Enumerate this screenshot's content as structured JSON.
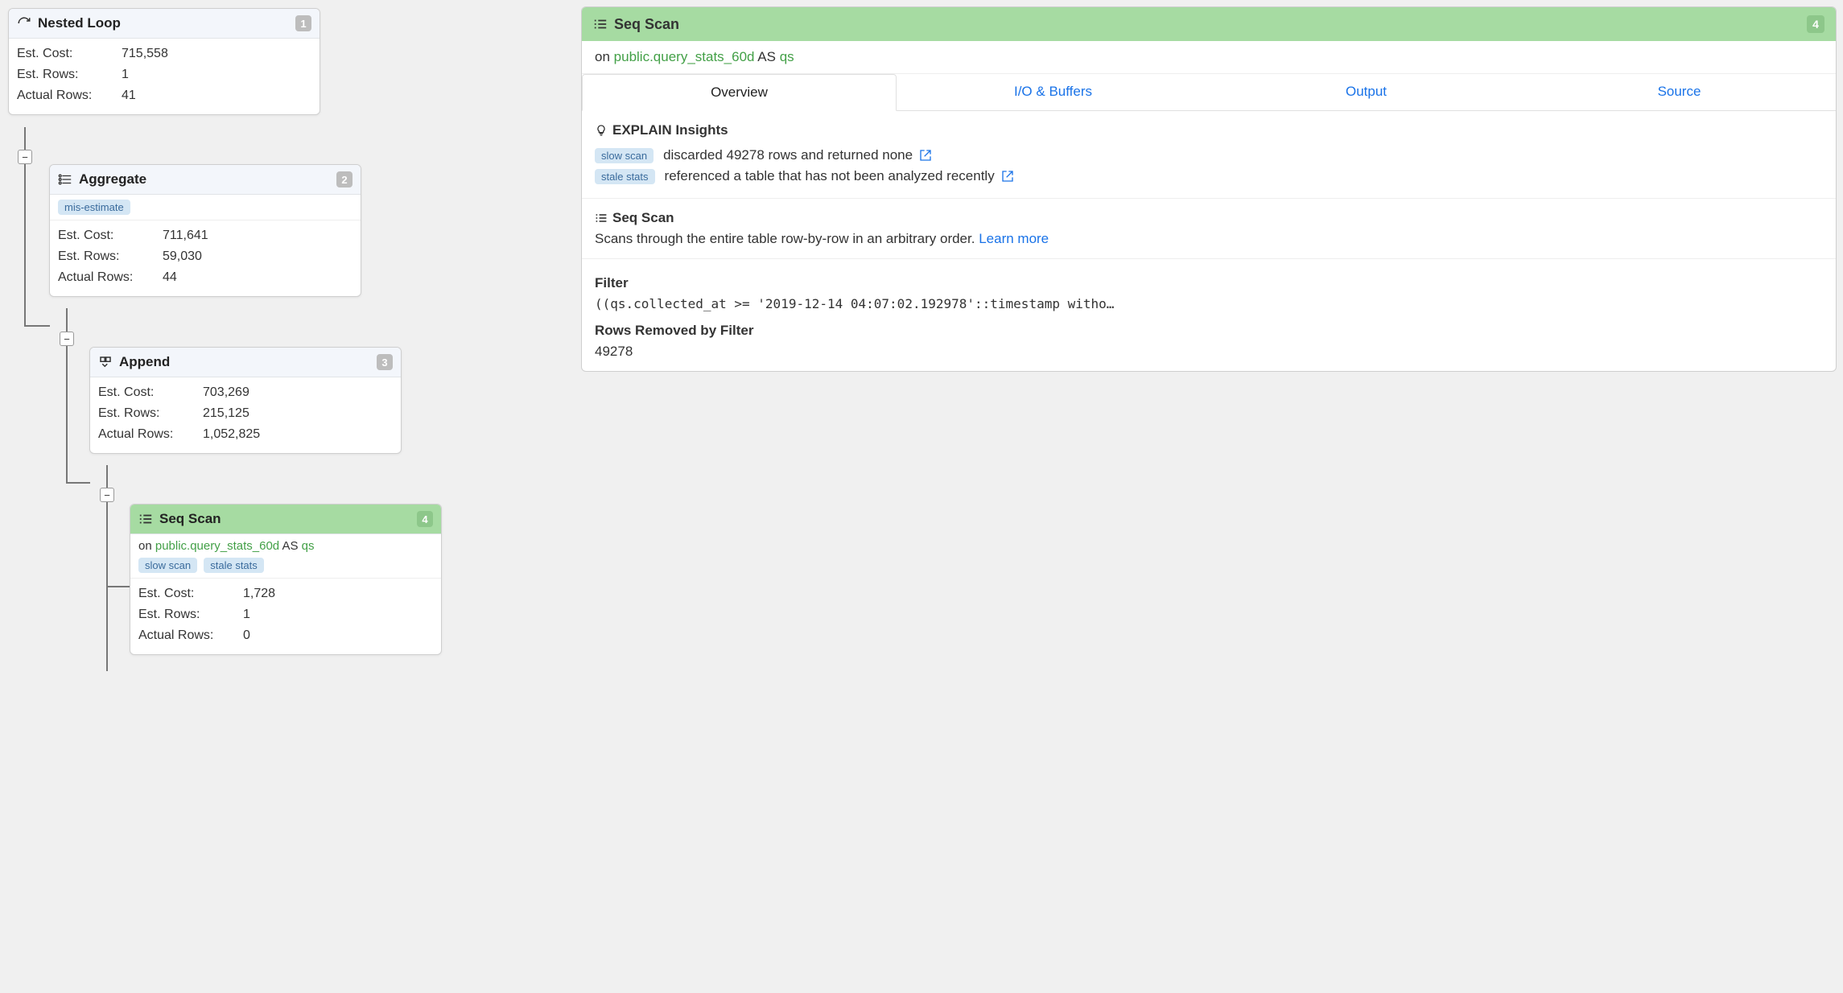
{
  "labels": {
    "est_cost": "Est. Cost:",
    "est_rows": "Est. Rows:",
    "actual_rows": "Actual Rows:",
    "on": "on",
    "as": "AS"
  },
  "tree": {
    "node1": {
      "title": "Nested Loop",
      "num": "1",
      "est_cost": "715,558",
      "est_rows": "1",
      "actual_rows": "41"
    },
    "node2": {
      "title": "Aggregate",
      "num": "2",
      "tag1": "mis-estimate",
      "est_cost": "711,641",
      "est_rows": "59,030",
      "actual_rows": "44"
    },
    "node3": {
      "title": "Append",
      "num": "3",
      "est_cost": "703,269",
      "est_rows": "215,125",
      "actual_rows": "1,052,825"
    },
    "node4": {
      "title": "Seq Scan",
      "num": "4",
      "relation": "public.query_stats_60d",
      "alias": "qs",
      "tag1": "slow scan",
      "tag2": "stale stats",
      "est_cost": "1,728",
      "est_rows": "1",
      "actual_rows": "0"
    }
  },
  "detail": {
    "title": "Seq Scan",
    "num": "4",
    "relation": "public.query_stats_60d",
    "alias": "qs",
    "tabs": {
      "overview": "Overview",
      "io": "I/O & Buffers",
      "output": "Output",
      "source": "Source"
    },
    "insights": {
      "heading": "EXPLAIN Insights",
      "row1_tag": "slow scan",
      "row1_text": "discarded 49278 rows and returned none",
      "row2_tag": "stale stats",
      "row2_text": "referenced a table that has not been analyzed recently"
    },
    "scan": {
      "title": "Seq Scan",
      "desc": "Scans through the entire table row-by-row in an arbitrary order.",
      "learn_more": "Learn more"
    },
    "filter": {
      "label": "Filter",
      "expr": "((qs.collected_at >= '2019-12-14 04:07:02.192978'::timestamp witho…",
      "removed_label": "Rows Removed by Filter",
      "removed_value": "49278"
    }
  }
}
